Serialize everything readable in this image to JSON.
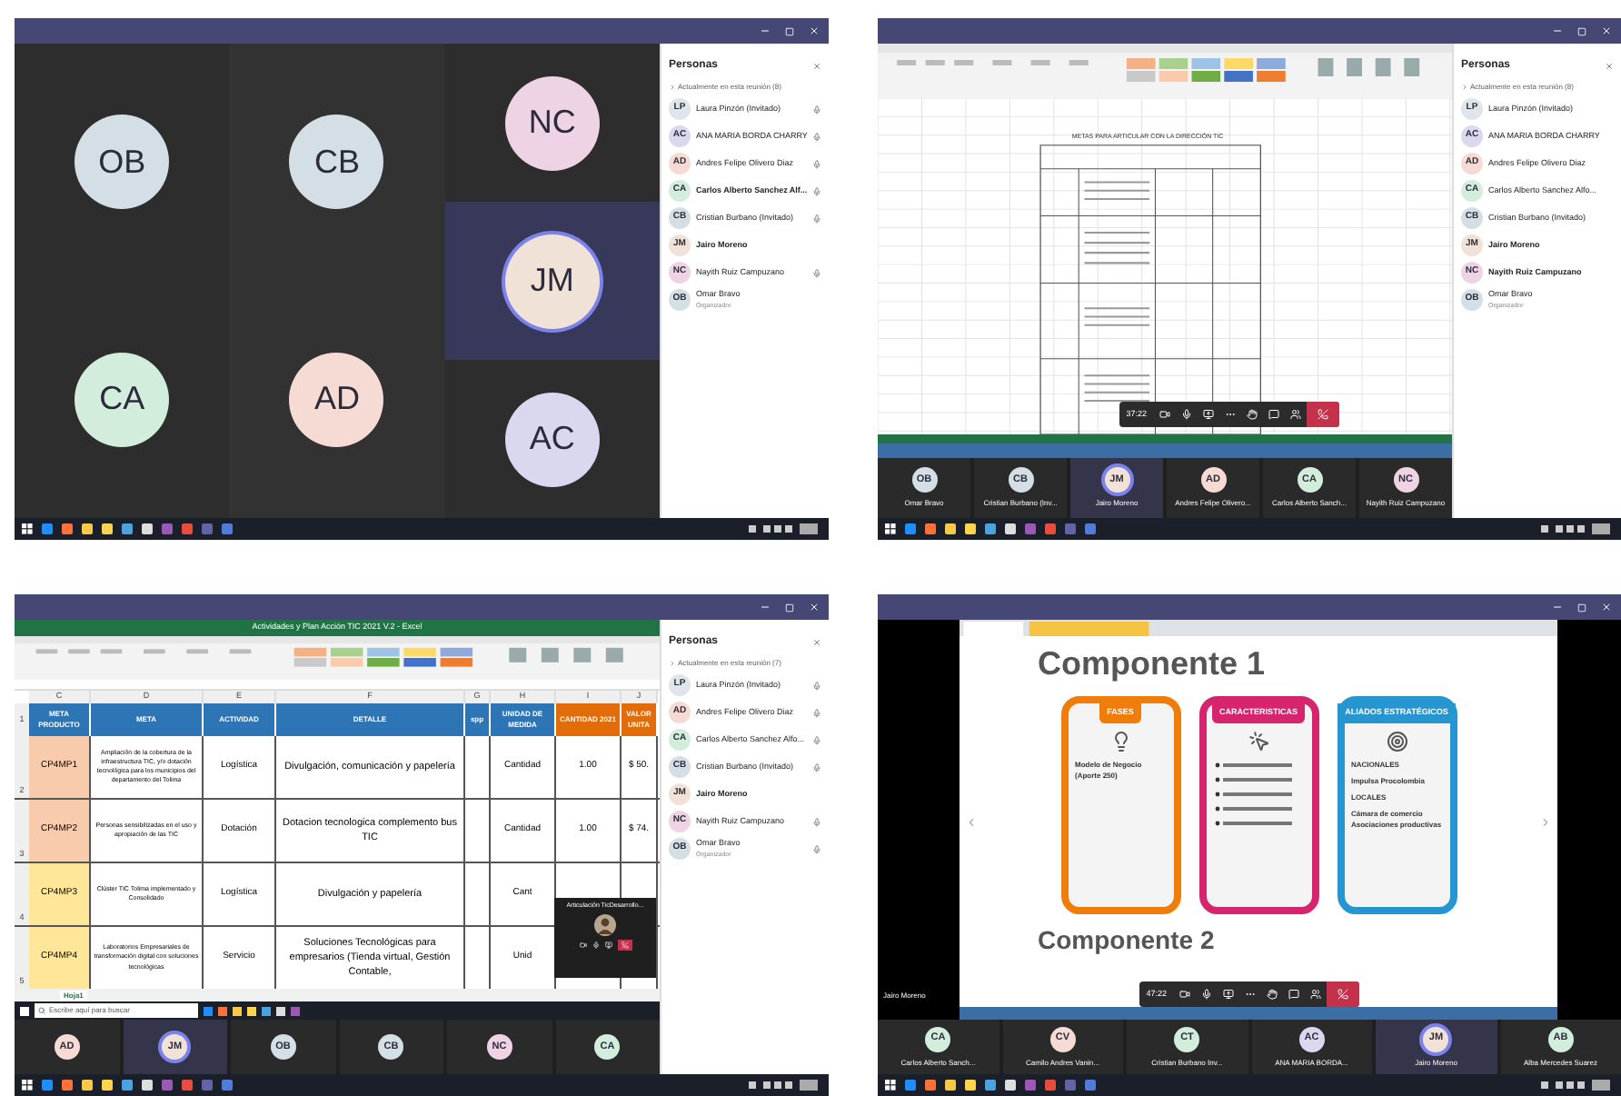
{
  "screens": [
    {
      "kind": "grid_call",
      "tile_columns": [
        [
          {
            "initials": "OB",
            "color": "#d3dfe4",
            "speaking": false
          },
          {
            "initials": "CA",
            "color": "#d3eddd",
            "speaking": false
          }
        ],
        [
          {
            "initials": "CB",
            "color": "#d3dfe4",
            "speaking": false
          },
          {
            "initials": "AD",
            "color": "#f6dbd4",
            "speaking": false
          }
        ],
        [
          {
            "initials": "NC",
            "color": "#eed3e4",
            "speaking": false
          },
          {
            "initials": "JM",
            "color": "#f1e2d8",
            "speaking": true
          },
          {
            "initials": "AC",
            "color": "#d9d8ef",
            "speaking": false
          }
        ]
      ],
      "people": {
        "title": "Personas",
        "section": "Actualmente en esta reunión (8)",
        "items": [
          {
            "initials": "LP",
            "color": "#dfe5ea",
            "name": "Laura Pinzón (Invitado)",
            "bold": false,
            "mic": true
          },
          {
            "initials": "AC",
            "color": "#d9d8ef",
            "name": "ANA MARIA BORDA CHARRY",
            "bold": false,
            "mic": true
          },
          {
            "initials": "AD",
            "color": "#f6dbd4",
            "name": "Andres Felipe Olivero Diaz",
            "bold": false,
            "mic": true
          },
          {
            "initials": "CA",
            "color": "#d3eddd",
            "name": "Carlos Alberto Sanchez Alf...",
            "bold": true,
            "mic": true
          },
          {
            "initials": "CB",
            "color": "#d3dfe4",
            "name": "Cristian Burbano (Invitado)",
            "bold": false,
            "mic": true
          },
          {
            "initials": "JM",
            "color": "#f1e2d8",
            "name": "Jairo Moreno",
            "bold": true,
            "mic": false
          },
          {
            "initials": "NC",
            "color": "#eed3e4",
            "name": "Nayith Ruiz Campuzano",
            "bold": false,
            "mic": true
          },
          {
            "initials": "OB",
            "color": "#d3dfe4",
            "name": "Omar Bravo",
            "subtitle": "Organizador",
            "bold": false,
            "mic": false
          }
        ]
      }
    },
    {
      "kind": "excel_call",
      "sheet_title": "METAS PARA ARTICULAR CON LA DIRECCIÓN TIC",
      "call_time": "37:22",
      "strip": [
        {
          "initials": "OB",
          "color": "#d3dfe4",
          "name": "Omar Bravo",
          "speaking": false
        },
        {
          "initials": "CB",
          "color": "#d3dfe4",
          "name": "Cristian Burbano (Inv...",
          "speaking": false
        },
        {
          "initials": "JM",
          "color": "#f1e2d8",
          "name": "Jairo Moreno",
          "speaking": true
        },
        {
          "initials": "AD",
          "color": "#f6dbd4",
          "name": "Andres Felipe Olivero...",
          "speaking": false
        },
        {
          "initials": "CA",
          "color": "#d3eddd",
          "name": "Carlos Alberto Sanch...",
          "speaking": false
        },
        {
          "initials": "NC",
          "color": "#eed3e4",
          "name": "Nayith Ruiz Campuzano",
          "speaking": false
        }
      ],
      "people": {
        "title": "Personas",
        "section": "Actualmente en esta reunión (8)",
        "items": [
          {
            "initials": "LP",
            "color": "#dfe5ea",
            "name": "Laura Pinzón (Invitado)",
            "bold": false,
            "mic": false
          },
          {
            "initials": "AC",
            "color": "#d9d8ef",
            "name": "ANA MARIA BORDA CHARRY",
            "bold": false,
            "mic": false
          },
          {
            "initials": "AD",
            "color": "#f6dbd4",
            "name": "Andres Felipe Olivero Diaz",
            "bold": false,
            "mic": false
          },
          {
            "initials": "CA",
            "color": "#d3eddd",
            "name": "Carlos Alberto Sanchez Alfo...",
            "bold": false,
            "mic": false
          },
          {
            "initials": "CB",
            "color": "#d3dfe4",
            "name": "Cristian Burbano (Invitado)",
            "bold": false,
            "mic": false
          },
          {
            "initials": "JM",
            "color": "#f1e2d8",
            "name": "Jairo Moreno",
            "bold": true,
            "mic": false
          },
          {
            "initials": "NC",
            "color": "#eed3e4",
            "name": "Nayith Ruiz Campuzano",
            "bold": true,
            "mic": false
          },
          {
            "initials": "OB",
            "color": "#d3dfe4",
            "name": "Omar Bravo",
            "subtitle": "Organizador",
            "bold": false,
            "mic": false
          }
        ]
      }
    },
    {
      "kind": "excel_detail_call",
      "excel_title": "Actividades y Plan Acción TIC 2021 V.2 - Excel",
      "columns": [
        {
          "letter": "C",
          "label": "META PRODUCTO",
          "color": "#2e75b6"
        },
        {
          "letter": "D",
          "label": "META",
          "color": "#2e75b6"
        },
        {
          "letter": "E",
          "label": "ACTIVIDAD",
          "color": "#2e75b6"
        },
        {
          "letter": "F",
          "label": "DETALLE",
          "color": "#2e75b6"
        },
        {
          "letter": "G",
          "label": "spp",
          "color": "#2e75b6"
        },
        {
          "letter": "H",
          "label": "UNIDAD DE MEDIDA",
          "color": "#2e75b6"
        },
        {
          "letter": "I",
          "label": "CANTIDAD 2021",
          "color": "#e26b0a"
        },
        {
          "letter": "J",
          "label": "VALOR UNITA",
          "color": "#e26b0a"
        }
      ],
      "header_row_number": "1",
      "rows": [
        {
          "number": "2",
          "color": "#f8cbad",
          "cells": [
            "CP4MP1",
            "Ampliación de la cobertura de la infraestructura TIC, y/o dotación tecnológica para los municipios del departamento del Tolima",
            "Logística",
            "Divulgación, comunicación y papelería",
            "",
            "Cantidad",
            "1.00",
            "$ 50."
          ]
        },
        {
          "number": "3",
          "color": "#f8cbad",
          "cells": [
            "CP4MP2",
            "Personas sensibilizadas en el uso y apropiación de las TIC",
            "Dotación",
            "Dotacion tecnologica complemento bus TIC",
            "",
            "Cantidad",
            "1.00",
            "$ 74."
          ]
        },
        {
          "number": "4",
          "color": "#ffe699",
          "cells": [
            "CP4MP3",
            "Clúster TIC Tolima implementado y Consolidado",
            "Logística",
            "Divulgación y papelería",
            "",
            "Cant",
            "",
            ""
          ]
        },
        {
          "number": "5",
          "color": "#ffe699",
          "cells": [
            "CP4MP4",
            "Laboratorios Empresariales de transformación digital con soluciones tecnológicas",
            "Servicio",
            "Soluciones Tecnológicas para empresarios (Tienda virtual, Gestión Contable,",
            "",
            "Unid",
            "",
            ""
          ]
        }
      ],
      "sheet_tab": "Hoja1",
      "search_placeholder": "Escribe aquí para buscar",
      "mini_call": {
        "title": "Articulación TicDesarrollo..."
      },
      "strip": [
        {
          "initials": "AD",
          "color": "#f6dbd4",
          "speaking": false
        },
        {
          "initials": "JM",
          "color": "#f1e2d8",
          "speaking": true
        },
        {
          "initials": "OB",
          "color": "#d3dfe4",
          "speaking": false
        },
        {
          "initials": "CB",
          "color": "#d3dfe4",
          "speaking": false
        },
        {
          "initials": "NC",
          "color": "#eed3e4",
          "speaking": false
        },
        {
          "initials": "CA",
          "color": "#d3eddd",
          "speaking": false
        }
      ],
      "people": {
        "title": "Personas",
        "section": "Actualmente en esta reunión (7)",
        "items": [
          {
            "initials": "LP",
            "color": "#dfe5ea",
            "name": "Laura Pinzón (Invitado)",
            "bold": false,
            "mic": true
          },
          {
            "initials": "AD",
            "color": "#f6dbd4",
            "name": "Andres Felipe Olivero Diaz",
            "bold": false,
            "mic": true
          },
          {
            "initials": "CA",
            "color": "#d3eddd",
            "name": "Carlos Alberto Sanchez Alfo...",
            "bold": false,
            "mic": true
          },
          {
            "initials": "CB",
            "color": "#d3dfe4",
            "name": "Cristian Burbano (Invitado)",
            "bold": false,
            "mic": true
          },
          {
            "initials": "JM",
            "color": "#f1e2d8",
            "name": "Jairo Moreno",
            "bold": true,
            "mic": false
          },
          {
            "initials": "NC",
            "color": "#eed3e4",
            "name": "Nayith Ruiz Campuzano",
            "bold": false,
            "mic": true
          },
          {
            "initials": "OB",
            "color": "#d3dfe4",
            "name": "Omar Bravo",
            "subtitle": "Organizador",
            "bold": false,
            "mic": true
          }
        ]
      }
    },
    {
      "kind": "slides_call",
      "call_time": "47:22",
      "presenter": "Jairo Moreno",
      "slide": {
        "heading": "Componente 1",
        "next_heading": "Componente 2",
        "cards": [
          {
            "title": "FASES",
            "color": "#f07d0a",
            "lines": [
              "Modelo de Negocio (Aporte 250)"
            ]
          },
          {
            "title": "CARACTERISTICAS",
            "color": "#d6246e"
          },
          {
            "title": "ALIADOS ESTRATÉGICOS",
            "color": "#2596cf",
            "lines": [
              "NACIONALES",
              "Impulsa Procolombia",
              "LOCALES",
              "Cámara de comercio Asociaciones productivas"
            ]
          }
        ]
      },
      "strip": [
        {
          "initials": "CA",
          "color": "#d3eddd",
          "name": "Carlos Alberto Sanch...",
          "speaking": false
        },
        {
          "initials": "CV",
          "color": "#f6dbd4",
          "name": "Camilo Andres Vanin...",
          "speaking": false
        },
        {
          "initials": "CT",
          "color": "#d3eddd",
          "name": "Cristian Burbano Inv...",
          "speaking": false
        },
        {
          "initials": "AC",
          "color": "#d9d8ef",
          "name": "ANA MARIA BORDA...",
          "speaking": false
        },
        {
          "initials": "JM",
          "color": "#f1e2d8",
          "name": "Jairo Moreno",
          "speaking": true
        },
        {
          "initials": "AB",
          "color": "#d3eddd",
          "name": "Alba Mercedes Suarez",
          "speaking": false
        }
      ]
    }
  ]
}
